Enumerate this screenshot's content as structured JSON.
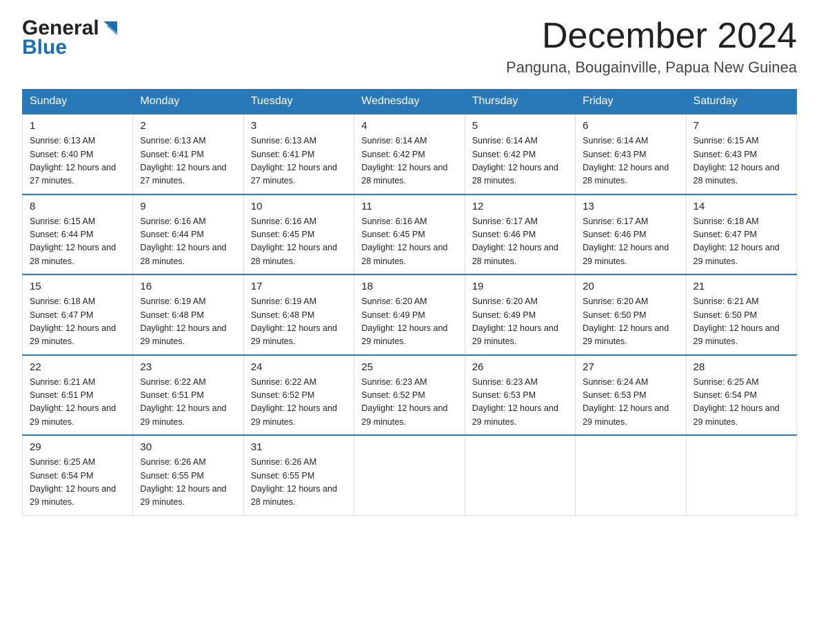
{
  "logo": {
    "general": "General",
    "blue": "Blue",
    "arrow_color": "#1a6fb5"
  },
  "title": {
    "month_year": "December 2024",
    "location": "Panguna, Bougainville, Papua New Guinea"
  },
  "weekdays": [
    "Sunday",
    "Monday",
    "Tuesday",
    "Wednesday",
    "Thursday",
    "Friday",
    "Saturday"
  ],
  "weeks": [
    [
      {
        "day": "1",
        "sunrise": "6:13 AM",
        "sunset": "6:40 PM",
        "daylight": "12 hours and 27 minutes."
      },
      {
        "day": "2",
        "sunrise": "6:13 AM",
        "sunset": "6:41 PM",
        "daylight": "12 hours and 27 minutes."
      },
      {
        "day": "3",
        "sunrise": "6:13 AM",
        "sunset": "6:41 PM",
        "daylight": "12 hours and 27 minutes."
      },
      {
        "day": "4",
        "sunrise": "6:14 AM",
        "sunset": "6:42 PM",
        "daylight": "12 hours and 28 minutes."
      },
      {
        "day": "5",
        "sunrise": "6:14 AM",
        "sunset": "6:42 PM",
        "daylight": "12 hours and 28 minutes."
      },
      {
        "day": "6",
        "sunrise": "6:14 AM",
        "sunset": "6:43 PM",
        "daylight": "12 hours and 28 minutes."
      },
      {
        "day": "7",
        "sunrise": "6:15 AM",
        "sunset": "6:43 PM",
        "daylight": "12 hours and 28 minutes."
      }
    ],
    [
      {
        "day": "8",
        "sunrise": "6:15 AM",
        "sunset": "6:44 PM",
        "daylight": "12 hours and 28 minutes."
      },
      {
        "day": "9",
        "sunrise": "6:16 AM",
        "sunset": "6:44 PM",
        "daylight": "12 hours and 28 minutes."
      },
      {
        "day": "10",
        "sunrise": "6:16 AM",
        "sunset": "6:45 PM",
        "daylight": "12 hours and 28 minutes."
      },
      {
        "day": "11",
        "sunrise": "6:16 AM",
        "sunset": "6:45 PM",
        "daylight": "12 hours and 28 minutes."
      },
      {
        "day": "12",
        "sunrise": "6:17 AM",
        "sunset": "6:46 PM",
        "daylight": "12 hours and 28 minutes."
      },
      {
        "day": "13",
        "sunrise": "6:17 AM",
        "sunset": "6:46 PM",
        "daylight": "12 hours and 29 minutes."
      },
      {
        "day": "14",
        "sunrise": "6:18 AM",
        "sunset": "6:47 PM",
        "daylight": "12 hours and 29 minutes."
      }
    ],
    [
      {
        "day": "15",
        "sunrise": "6:18 AM",
        "sunset": "6:47 PM",
        "daylight": "12 hours and 29 minutes."
      },
      {
        "day": "16",
        "sunrise": "6:19 AM",
        "sunset": "6:48 PM",
        "daylight": "12 hours and 29 minutes."
      },
      {
        "day": "17",
        "sunrise": "6:19 AM",
        "sunset": "6:48 PM",
        "daylight": "12 hours and 29 minutes."
      },
      {
        "day": "18",
        "sunrise": "6:20 AM",
        "sunset": "6:49 PM",
        "daylight": "12 hours and 29 minutes."
      },
      {
        "day": "19",
        "sunrise": "6:20 AM",
        "sunset": "6:49 PM",
        "daylight": "12 hours and 29 minutes."
      },
      {
        "day": "20",
        "sunrise": "6:20 AM",
        "sunset": "6:50 PM",
        "daylight": "12 hours and 29 minutes."
      },
      {
        "day": "21",
        "sunrise": "6:21 AM",
        "sunset": "6:50 PM",
        "daylight": "12 hours and 29 minutes."
      }
    ],
    [
      {
        "day": "22",
        "sunrise": "6:21 AM",
        "sunset": "6:51 PM",
        "daylight": "12 hours and 29 minutes."
      },
      {
        "day": "23",
        "sunrise": "6:22 AM",
        "sunset": "6:51 PM",
        "daylight": "12 hours and 29 minutes."
      },
      {
        "day": "24",
        "sunrise": "6:22 AM",
        "sunset": "6:52 PM",
        "daylight": "12 hours and 29 minutes."
      },
      {
        "day": "25",
        "sunrise": "6:23 AM",
        "sunset": "6:52 PM",
        "daylight": "12 hours and 29 minutes."
      },
      {
        "day": "26",
        "sunrise": "6:23 AM",
        "sunset": "6:53 PM",
        "daylight": "12 hours and 29 minutes."
      },
      {
        "day": "27",
        "sunrise": "6:24 AM",
        "sunset": "6:53 PM",
        "daylight": "12 hours and 29 minutes."
      },
      {
        "day": "28",
        "sunrise": "6:25 AM",
        "sunset": "6:54 PM",
        "daylight": "12 hours and 29 minutes."
      }
    ],
    [
      {
        "day": "29",
        "sunrise": "6:25 AM",
        "sunset": "6:54 PM",
        "daylight": "12 hours and 29 minutes."
      },
      {
        "day": "30",
        "sunrise": "6:26 AM",
        "sunset": "6:55 PM",
        "daylight": "12 hours and 29 minutes."
      },
      {
        "day": "31",
        "sunrise": "6:26 AM",
        "sunset": "6:55 PM",
        "daylight": "12 hours and 28 minutes."
      },
      null,
      null,
      null,
      null
    ]
  ],
  "labels": {
    "sunrise": "Sunrise:",
    "sunset": "Sunset:",
    "daylight": "Daylight:"
  }
}
